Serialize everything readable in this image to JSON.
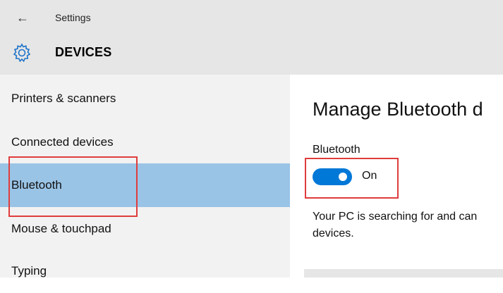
{
  "header": {
    "back_icon": "back-arrow-icon",
    "settings_title": "Settings",
    "section_icon": "gear-icon",
    "section_title": "DEVICES"
  },
  "sidebar": {
    "items": [
      {
        "label": "Printers & scanners",
        "active": false
      },
      {
        "label": "Connected devices",
        "active": false
      },
      {
        "label": "Bluetooth",
        "active": true
      },
      {
        "label": "Mouse & touchpad",
        "active": false
      },
      {
        "label": "Typing",
        "active": false
      }
    ]
  },
  "main": {
    "title": "Manage Bluetooth d",
    "bluetooth_label": "Bluetooth",
    "toggle": {
      "state": "On",
      "on": true
    },
    "description": "Your PC is searching for and can devices."
  },
  "colors": {
    "header_bg": "#e6e6e6",
    "sidebar_bg": "#f2f2f2",
    "active_item_bg": "#9ac4e6",
    "accent": "#0078d7",
    "icon_blue": "#1e73c8",
    "highlight_red": "#e03c3c"
  }
}
